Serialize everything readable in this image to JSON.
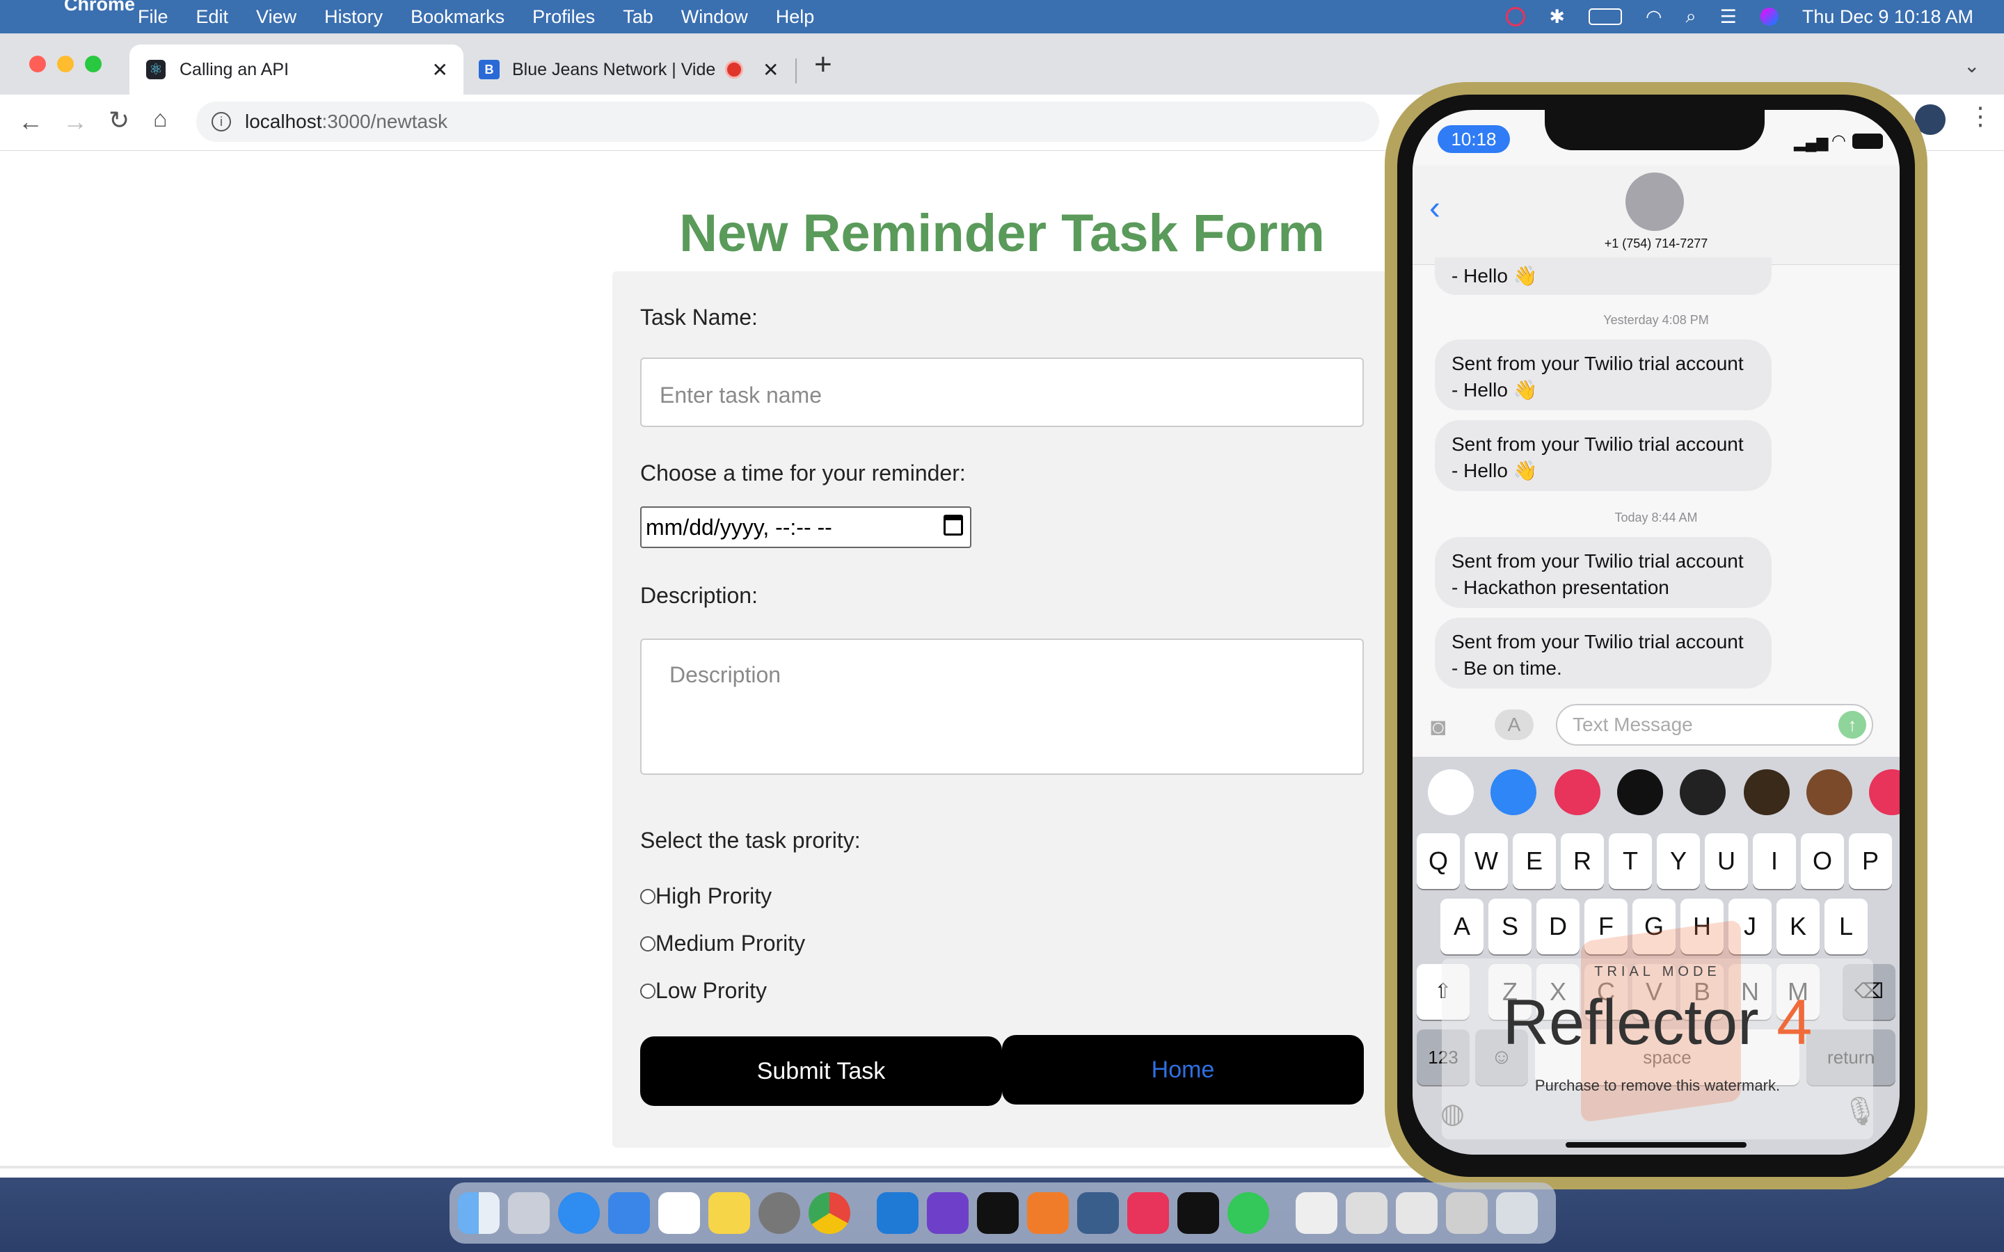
{
  "menubar": {
    "app": "Chrome",
    "items": [
      "File",
      "Edit",
      "View",
      "History",
      "Bookmarks",
      "Profiles",
      "Tab",
      "Window",
      "Help"
    ],
    "datetime": "Thu Dec 9  10:18 AM"
  },
  "browser": {
    "tabs": [
      {
        "title": "Calling an API"
      },
      {
        "title": "Blue Jeans Network | Vide"
      }
    ],
    "address_host": "localhost",
    "address_path": ":3000/newtask"
  },
  "form": {
    "title": "New Reminder Task Form",
    "task_name_label": "Task Name:",
    "task_name_placeholder": "Enter task name",
    "time_label": "Choose a time for your reminder:",
    "time_value": "mm/dd/yyyy, --:-- --",
    "description_label": "Description:",
    "description_placeholder": "Description",
    "priority_label": "Select the task prority:",
    "priorities": [
      "High Prority",
      "Medium Prority",
      "Low Prority"
    ],
    "submit_label": "Submit Task",
    "home_label": "Home"
  },
  "phone": {
    "time": "10:18",
    "contact": "+1 (754) 714-7277",
    "messages_top_fragment": "- Hello 👋",
    "timestamp1": "Yesterday 4:08 PM",
    "msg1_line1": "Sent from your Twilio trial account",
    "msg1_line2": "- Hello 👋",
    "msg2_line1": "Sent from your Twilio trial account",
    "msg2_line2": "- Hello 👋",
    "timestamp2": "Today 8:44 AM",
    "msg3_line1": "Sent from your Twilio trial account",
    "msg3_line2": "- Hackathon presentation",
    "msg4_line1": "Sent from your Twilio trial account",
    "msg4_line2": "- Be on time.",
    "compose_placeholder": "Text Message",
    "keyboard_row1": [
      "Q",
      "W",
      "E",
      "R",
      "T",
      "Y",
      "U",
      "I",
      "O",
      "P"
    ],
    "keyboard_row2": [
      "A",
      "S",
      "D",
      "F",
      "G",
      "H",
      "J",
      "K",
      "L"
    ],
    "keyboard_row3": [
      "Z",
      "X",
      "C",
      "V",
      "B",
      "N",
      "M"
    ],
    "key_123": "123",
    "key_space": "space",
    "key_return": "return"
  },
  "watermark": {
    "trial": "TRIAL MODE",
    "brand": "Reflector",
    "version": "4",
    "purchase": "Purchase to remove this watermark."
  },
  "colors": {
    "title_green": "#5a9a5a",
    "home_link_blue": "#2f6fe0",
    "accent_orange": "#f06a3a"
  }
}
